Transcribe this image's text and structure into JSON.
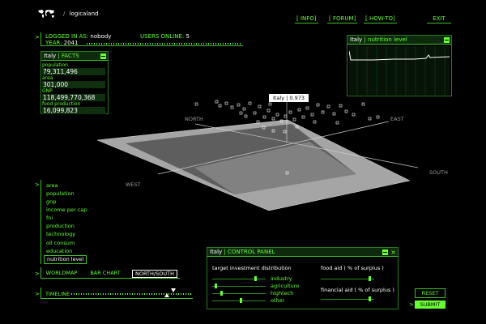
{
  "app": {
    "title": "logicaland"
  },
  "nav": {
    "info": "[ INFO]",
    "forum": "[ FORUM]",
    "howto": "[ HOW-TO]",
    "exit": "EXIT"
  },
  "status": {
    "logged_label": "LOGGED IN AS:",
    "logged_user": "nobody",
    "users_online_label": "USERS ONLINE:",
    "users_online": "5",
    "year_label": "YEAR:",
    "year": "2041"
  },
  "facts": {
    "country": "Italy",
    "title": "| FACTS",
    "items": [
      {
        "label": "population",
        "value": "79,311,496"
      },
      {
        "label": "area",
        "value": "301,000"
      },
      {
        "label": "GNP",
        "value": "118,499,770,368"
      },
      {
        "label": "food production",
        "value": "16,099,823"
      }
    ]
  },
  "nutrition": {
    "country": "Italy",
    "title": "| nutrition level"
  },
  "map": {
    "tooltip": "Italy | 0.973",
    "north": "NORTH",
    "east": "EAST",
    "south": "SOUTH",
    "west": "WEST"
  },
  "menu": {
    "items": [
      "area",
      "population",
      "gnp",
      "income per cap",
      "fni",
      "production",
      "technology",
      "oil consum",
      "education",
      "nutrition level"
    ],
    "selected": "nutrition level"
  },
  "view_tabs": {
    "worldmap": "WORLDMAP",
    "barchart": "BAR CHART",
    "northsouth": "NORTH/SOUTH",
    "active": "NORTH/SOUTH"
  },
  "timeline": {
    "label": "TIMELINE"
  },
  "control_panel": {
    "country": "Italy",
    "title": "| CONTROL PANEL",
    "investment_label": "target investment distribution",
    "investment_options": [
      "industry",
      "agriculture",
      "hightech",
      "other"
    ],
    "food_aid_label": "food aid  ( % of surplus )",
    "financial_aid_label": "financial aid  ( % of surplus )"
  },
  "buttons": {
    "reset": "RESET",
    "submit": "SUBMIT"
  },
  "colors": {
    "accent": "#66ff33",
    "background": "#000000",
    "panel_fill": "#0f2f0f",
    "submit_bg": "#66ff33"
  },
  "icons": {
    "logo": "world-map-icon",
    "minimize": "minimize-icon",
    "close": "close-icon",
    "arrow": "chevron-right-icon"
  }
}
